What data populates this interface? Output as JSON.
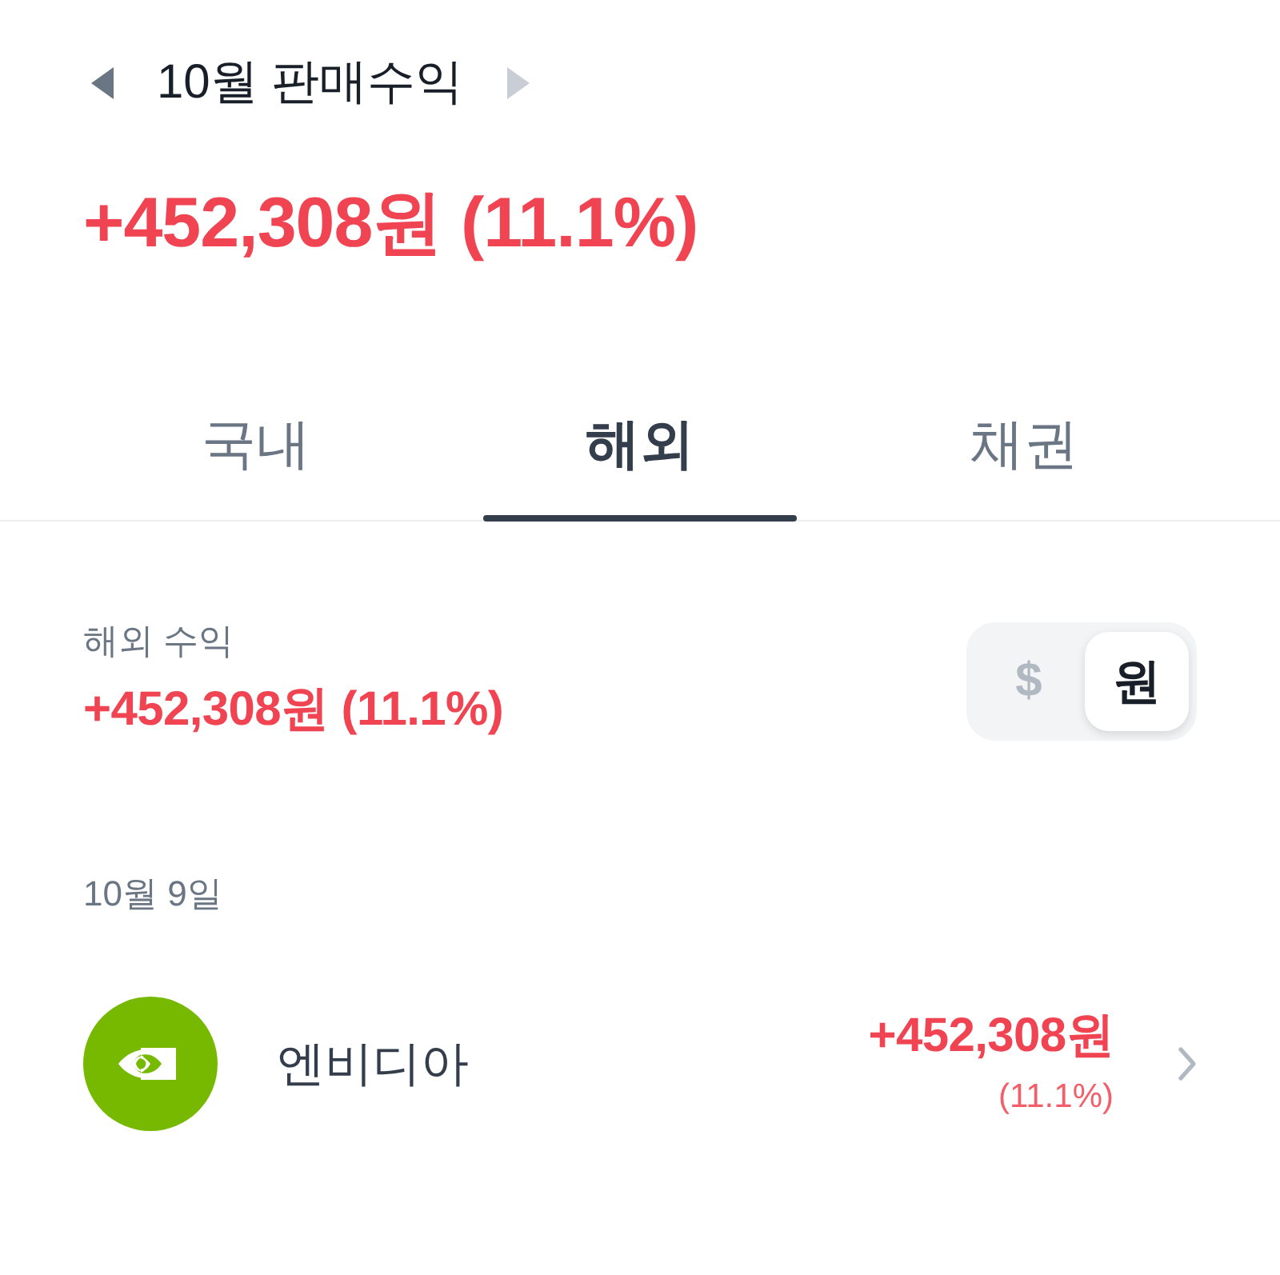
{
  "header": {
    "title": "10월 판매수익",
    "prev": {
      "disabled": false
    },
    "next": {
      "disabled": true
    }
  },
  "total": {
    "amount": "+452,308원 (11.1%)"
  },
  "tabs": [
    {
      "label": "국내",
      "selected": false
    },
    {
      "label": "해외",
      "selected": true
    },
    {
      "label": "채권",
      "selected": false
    }
  ],
  "summary": {
    "label": "해외 수익",
    "amount": "+452,308원 (11.1%)",
    "currency_toggle": [
      {
        "label": "$",
        "selected": false
      },
      {
        "label": "원",
        "selected": true
      }
    ]
  },
  "groups": [
    {
      "date": "10월 9일",
      "items": [
        {
          "name": "엔비디아",
          "color": "#76b900",
          "amount": "+452,308원",
          "rate": "(11.1%)"
        }
      ]
    }
  ]
}
